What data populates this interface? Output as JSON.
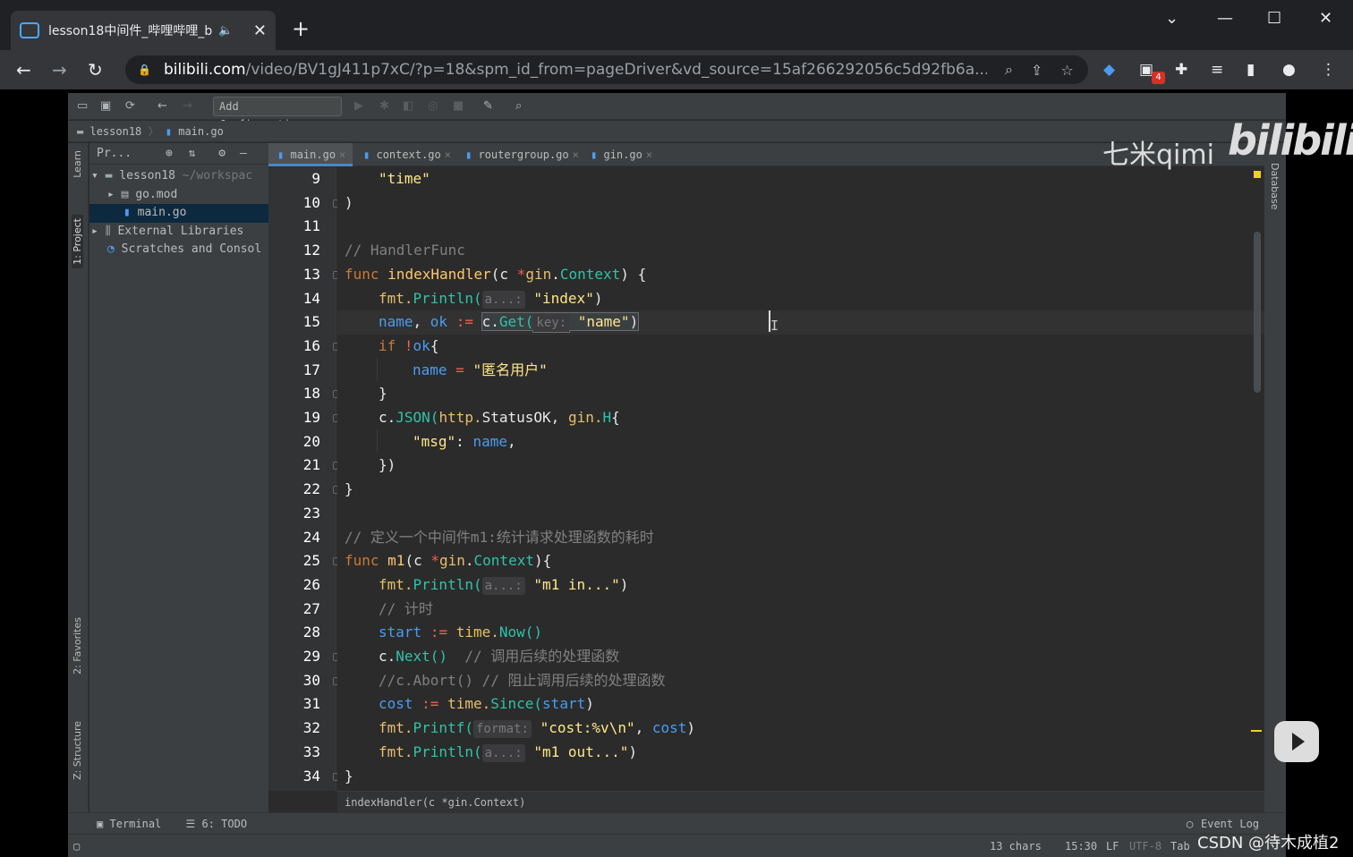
{
  "browser": {
    "tab_title": "lesson18中间件_哔哩哔哩_b",
    "tab_close": "✕",
    "new_tab": "+",
    "url_host": "bilibili.com",
    "url_path": "/video/BV1gJ411p7xC/?p=18&spm_id_from=pageDriver&vd_source=15af266292056c5d92fb6a...",
    "extension_badge": "4"
  },
  "ide": {
    "add_configuration": "Add Configuration...",
    "breadcrumb": {
      "project": "lesson18",
      "file": "main.go"
    },
    "left_strip": {
      "learn": "Learn",
      "project": "1: Project",
      "favorites": "2: Favorites",
      "structure": "Z: Structure"
    },
    "right_strip": {
      "database": "Database"
    },
    "project_panel": {
      "title": "Pr...",
      "tree": [
        {
          "label": "lesson18",
          "hint": "~/workspac"
        },
        {
          "label": "go.mod"
        },
        {
          "label": "main.go"
        },
        {
          "label": "External Libraries"
        },
        {
          "label": "Scratches and Consol"
        }
      ]
    },
    "tabs": [
      "main.go",
      "context.go",
      "routergroup.go",
      "gin.go"
    ],
    "line_numbers": [
      "9",
      "10",
      "11",
      "12",
      "13",
      "14",
      "15",
      "16",
      "17",
      "18",
      "19",
      "20",
      "21",
      "22",
      "23",
      "24",
      "25",
      "26",
      "27",
      "28",
      "29",
      "30",
      "31",
      "32",
      "33",
      "34"
    ],
    "code": {
      "l9": "\"time\"",
      "l10": ")",
      "l12": "// HandlerFunc",
      "l13_kw": "func",
      "l13_fn": "indexHandler",
      "l13_rest1": "(c ",
      "l13_star": "*",
      "l13_pkg": "gin",
      "l13_dot": ".",
      "l13_type": "Context",
      "l13_rest2": ") {",
      "l14_fmt": "fmt.",
      "l14_fn": "Println(",
      "hint_a": "a...:",
      "l14_str": "\"index\"",
      "close_paren": ")",
      "l15_name": "name",
      "l15_comma": ", ",
      "l15_ok": "ok",
      "l15_assign": ":=",
      "l15_c": "c.",
      "l15_get": "Get(",
      "hint_key": "key:",
      "l15_str": "\"name\"",
      "l16_if": "if",
      "l16_not": "!",
      "l16_ok": "ok",
      "l16_brace": "{",
      "l17_name": "name",
      "l17_eq": "=",
      "l17_str": "\"匿名用户\"",
      "brace_close": "}",
      "l19_c": "c.",
      "l19_json": "JSON(",
      "l19_http": "http.",
      "l19_status": "StatusOK",
      "l19_mid": ", ",
      "l19_gin": "gin.",
      "l19_h": "H",
      "l19_brace": "{",
      "l20_str": "\"msg\"",
      "l20_colon": ": ",
      "l20_name": "name",
      "l20_comma": ",",
      "l21": "})",
      "l24": "// 定义一个中间件m1:统计请求处理函数的耗时",
      "l25_fn": "m1",
      "l25_rest2": "){",
      "l26_str": "\"m1 in...\"",
      "l27": "// 计时",
      "l28_start": "start",
      "l28_time": "time.",
      "l28_now": "Now()",
      "l29_c": "c.",
      "l29_next": "Next()",
      "l29_cm": "  // 调用后续的处理函数",
      "l30": "//c.Abort() // 阻止调用后续的处理函数",
      "l31_cost": "cost",
      "l31_since": "Since(",
      "l31_start": "start",
      "l32_fn": "Printf(",
      "hint_format": "format:",
      "l32_str": "\"cost:%v\\n\"",
      "l32_comma": ", ",
      "l32_cost": "cost",
      "l33_str": "\"m1 out...\""
    },
    "code_status": "indexHandler(c *gin.Context)",
    "bottom_tabs": {
      "terminal": "Terminal",
      "todo": "6: TODO",
      "event_log": "Event Log"
    },
    "status": {
      "chars": "13 chars",
      "position": "15:30",
      "line_sep": "LF",
      "encoding": "UTF-8",
      "indent": "Tab"
    }
  },
  "watermark": {
    "qimi": "七米qimi",
    "bilibili": "bilibili",
    "csdn": "CSDN @待木成植2"
  }
}
